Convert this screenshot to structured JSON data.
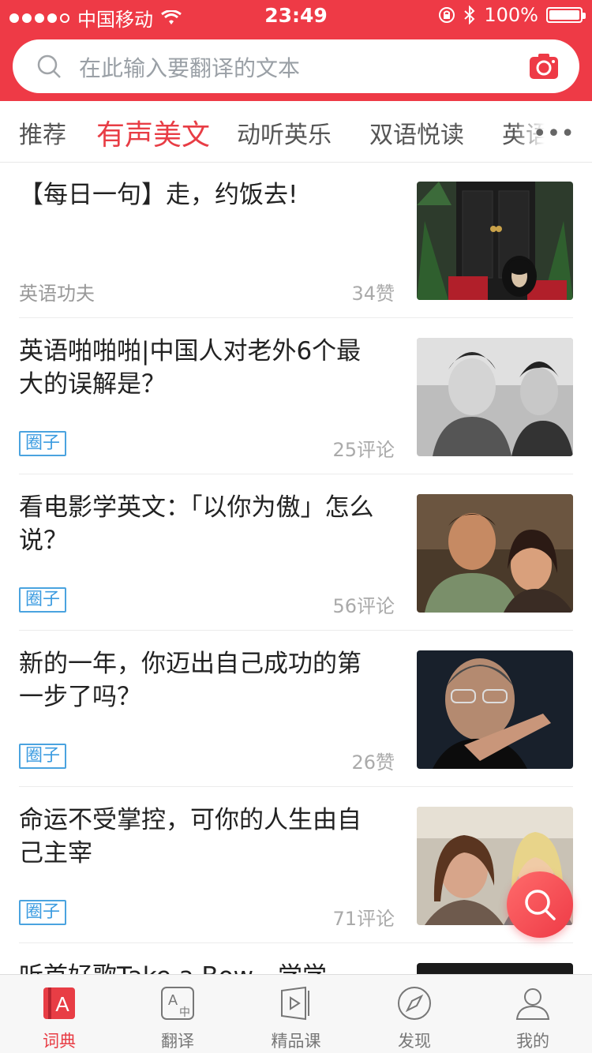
{
  "status": {
    "carrier": "中国移动",
    "time": "23:49",
    "battery": "100%"
  },
  "search": {
    "placeholder": "在此输入要翻译的文本"
  },
  "tabs": [
    {
      "label": "推荐"
    },
    {
      "label": "有声美文"
    },
    {
      "label": "动听英乐"
    },
    {
      "label": "双语悦读"
    },
    {
      "label": "英语"
    }
  ],
  "feed": [
    {
      "title": "【每日一句】走，约饭去!",
      "source": "英语功夫",
      "meta": "34赞"
    },
    {
      "title": "英语啪啪啪|中国人对老外6个最大的误解是？",
      "badge": "圈子",
      "meta": "25评论"
    },
    {
      "title": "看电影学英文：「以你为傲」怎么说？",
      "badge": "圈子",
      "meta": "56评论"
    },
    {
      "title": "新的一年，你迈出自己成功的第一步了吗？",
      "badge": "圈子",
      "meta": "26赞"
    },
    {
      "title": "命运不受掌控，可你的人生由自己主宰",
      "badge": "圈子",
      "meta": "71评论"
    },
    {
      "title": "听首好歌Take a Bow，学学"
    }
  ],
  "tabbar": [
    {
      "label": "词典",
      "icon": "dictionary-icon"
    },
    {
      "label": "翻译",
      "icon": "translate-icon"
    },
    {
      "label": "精品课",
      "icon": "course-icon"
    },
    {
      "label": "发现",
      "icon": "compass-icon"
    },
    {
      "label": "我的",
      "icon": "profile-icon"
    }
  ],
  "colors": {
    "brand": "#ee3a46",
    "badge": "#3b9be0"
  }
}
